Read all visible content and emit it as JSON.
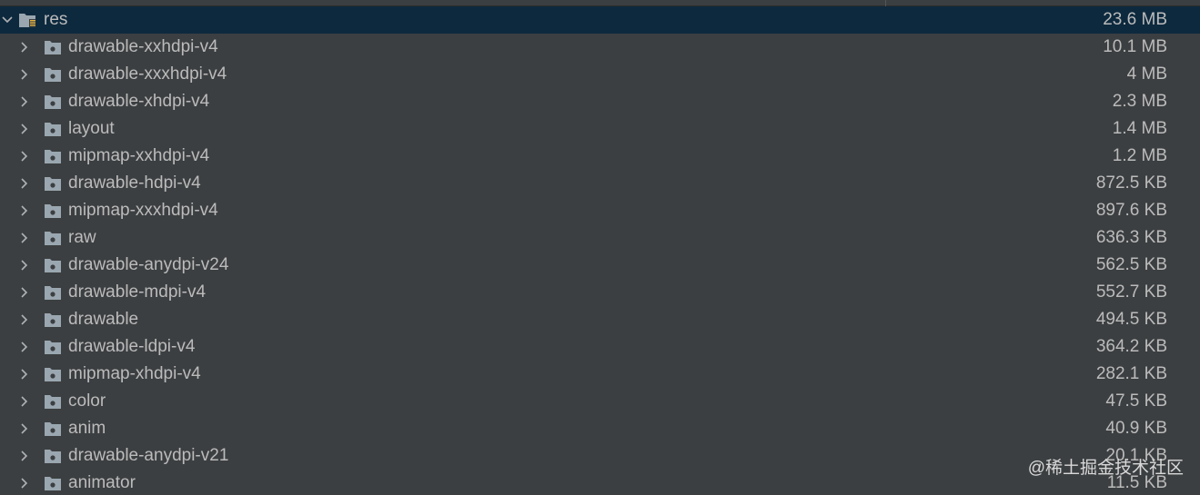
{
  "tree": {
    "root": {
      "name": "res",
      "size": "23.6 MB",
      "expanded": true,
      "selected": true,
      "icon": "resource-folder-icon"
    },
    "items": [
      {
        "name": "drawable-xxhdpi-v4",
        "size": "10.1 MB"
      },
      {
        "name": "drawable-xxxhdpi-v4",
        "size": "4 MB"
      },
      {
        "name": "drawable-xhdpi-v4",
        "size": "2.3 MB"
      },
      {
        "name": "layout",
        "size": "1.4 MB"
      },
      {
        "name": "mipmap-xxhdpi-v4",
        "size": "1.2 MB"
      },
      {
        "name": "drawable-hdpi-v4",
        "size": "872.5 KB"
      },
      {
        "name": "mipmap-xxxhdpi-v4",
        "size": "897.6 KB"
      },
      {
        "name": "raw",
        "size": "636.3 KB"
      },
      {
        "name": "drawable-anydpi-v24",
        "size": "562.5 KB"
      },
      {
        "name": "drawable-mdpi-v4",
        "size": "552.7 KB"
      },
      {
        "name": "drawable",
        "size": "494.5 KB"
      },
      {
        "name": "drawable-ldpi-v4",
        "size": "364.2 KB"
      },
      {
        "name": "mipmap-xhdpi-v4",
        "size": "282.1 KB"
      },
      {
        "name": "color",
        "size": "47.5 KB"
      },
      {
        "name": "anim",
        "size": "40.9 KB"
      },
      {
        "name": "drawable-anydpi-v21",
        "size": "20.1 KB"
      },
      {
        "name": "animator",
        "size": "11.5 KB"
      }
    ]
  },
  "watermark": "@稀土掘金技术社区",
  "colors": {
    "background": "#3c3f41",
    "selected_row": "#0d293e",
    "text": "#bbbbbb",
    "folder_icon": "#9aa7b0",
    "arrow": "#afb1b3"
  }
}
